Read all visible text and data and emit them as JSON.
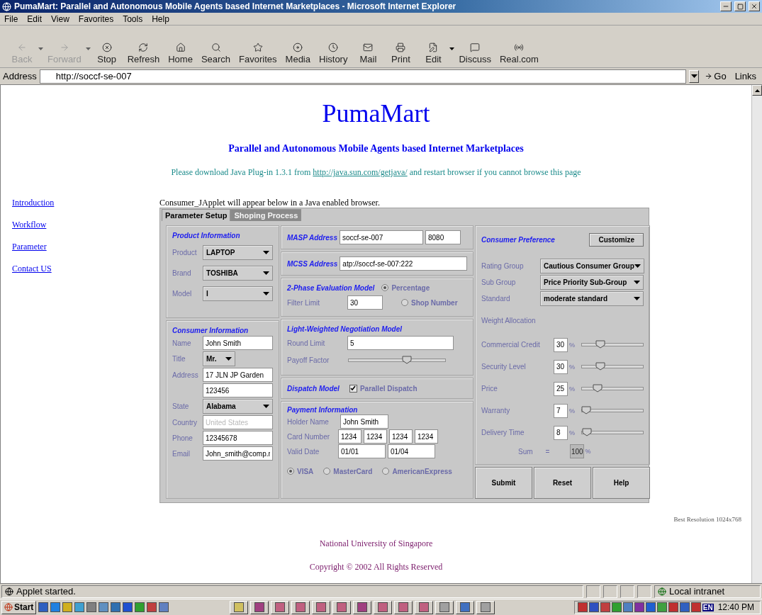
{
  "window": {
    "title": "PumaMart: Parallel and Autonomous Mobile Agents based Internet Marketplaces - Microsoft Internet Explorer"
  },
  "menu": [
    "File",
    "Edit",
    "View",
    "Favorites",
    "Tools",
    "Help"
  ],
  "toolbar": [
    {
      "label": "Back",
      "disabled": true,
      "dropdown": true
    },
    {
      "label": "Forward",
      "disabled": true,
      "dropdown": true
    },
    {
      "label": "Stop",
      "disabled": false,
      "dropdown": false
    },
    {
      "label": "Refresh",
      "disabled": false,
      "dropdown": false
    },
    {
      "label": "Home",
      "disabled": false,
      "dropdown": false
    },
    {
      "label": "Search",
      "disabled": false,
      "dropdown": false
    },
    {
      "label": "Favorites",
      "disabled": false,
      "dropdown": false
    },
    {
      "label": "Media",
      "disabled": false,
      "dropdown": false
    },
    {
      "label": "History",
      "disabled": false,
      "dropdown": false
    },
    {
      "label": "Mail",
      "disabled": false,
      "dropdown": false
    },
    {
      "label": "Print",
      "disabled": false,
      "dropdown": false
    },
    {
      "label": "Edit",
      "disabled": false,
      "dropdown": true
    },
    {
      "label": "Discuss",
      "disabled": false,
      "dropdown": false
    },
    {
      "label": "Real.com",
      "disabled": false,
      "dropdown": false
    }
  ],
  "address": {
    "label": "Address",
    "value": "http://soccf-se-007",
    "go": "Go",
    "links": "Links"
  },
  "page": {
    "title": "PumaMart",
    "subtitle": "Parallel and Autonomous Mobile Agents based Internet Marketplaces",
    "notice": {
      "before": "Please download Java Plug-in 1.3.1 from",
      "link": "http://java.sun.com/getjava/",
      "after": "and restart browser if you cannot browse this page"
    },
    "nav": [
      "Introduction",
      "Workflow",
      "Parameter",
      "Contact US"
    ],
    "applet_note": "Consumer_JApplet will appear below in a Java enabled browser.",
    "resolution": "Best Resolution 1024x768",
    "university": "National University of Singapore",
    "copyright": "Copyright © 2002 All Rights Reserved"
  },
  "applet": {
    "tabs": [
      {
        "label": "Parameter Setup",
        "selected": true
      },
      {
        "label": "Shoping Process",
        "selected": false
      }
    ],
    "product": {
      "heading": "Product Information",
      "fields": [
        {
          "label": "Product",
          "kind": "select",
          "value": "LAPTOP"
        },
        {
          "label": "Brand",
          "kind": "select",
          "value": "TOSHIBA"
        },
        {
          "label": "Model",
          "kind": "select",
          "value": "I"
        }
      ]
    },
    "consumer": {
      "heading": "Consumer Information",
      "fields": [
        {
          "label": "Name",
          "kind": "text",
          "value": "John Smith"
        },
        {
          "label": "Title",
          "kind": "small-select",
          "value": "Mr."
        },
        {
          "label": "Address",
          "kind": "text",
          "value": "17 JLN JP Garden"
        },
        {
          "kind": "text",
          "value": "123456"
        },
        {
          "label": "State",
          "kind": "select",
          "value": "Alabama"
        },
        {
          "label": "Country",
          "kind": "disabled",
          "value": "United States"
        },
        {
          "label": "Phone",
          "kind": "text",
          "value": "12345678"
        },
        {
          "label": "Email",
          "kind": "text",
          "value": "John_smith@comp.r"
        }
      ]
    },
    "masp": {
      "label": "MASP Address",
      "host": "soccf-se-007",
      "port": "8080"
    },
    "mcss": {
      "label": "MCSS Address",
      "value": "atp://soccf-se-007:222"
    },
    "evaluation": {
      "heading": "2-Phase Evaluation Model",
      "filter_label": "Filter Limit",
      "filter_value": "30",
      "options": [
        {
          "label": "Percentage",
          "selected": true
        },
        {
          "label": "Shop Number",
          "selected": false
        }
      ]
    },
    "negotiation": {
      "heading": "Light-Weighted Negotiation Model",
      "round_label": "Round Limit",
      "round_value": "5",
      "payoff_label": "Payoff Factor",
      "level": 0.6
    },
    "dispatch": {
      "heading": "Dispatch Model",
      "label": "Parallel Dispatch",
      "checked": true
    },
    "payment": {
      "heading": "Payment Information",
      "holder_label": "Holder Name",
      "holder": "John Smith",
      "card_label": "Card Number",
      "card": [
        "1234",
        "1234",
        "1234",
        "1234"
      ],
      "valid_label": "Valid Date",
      "valid": [
        "01/01",
        "01/04"
      ],
      "cards": [
        {
          "label": "VISA",
          "selected": true
        },
        {
          "label": "MasterCard",
          "selected": false
        },
        {
          "label": "AmericanExpress",
          "selected": false
        }
      ]
    },
    "preference": {
      "heading": "Consumer Preference",
      "customize": "Customize",
      "groups": [
        {
          "label": "Rating Group",
          "value": "Cautious Consumer Group"
        },
        {
          "label": "Sub Group",
          "value": "Price Priority Sub-Group"
        },
        {
          "label": "Standard",
          "value": "moderate standard"
        }
      ],
      "weight_heading": "Weight Allocation",
      "weights": [
        {
          "label": "Commercial Credit",
          "value": "30",
          "unit": "%",
          "level": 0.3
        },
        {
          "label": "Security Level",
          "value": "30",
          "unit": "%",
          "level": 0.3
        },
        {
          "label": "Price",
          "value": "25",
          "unit": "%",
          "level": 0.25
        },
        {
          "label": "Warranty",
          "value": "7",
          "unit": "%",
          "level": 0.07
        },
        {
          "label": "Delivery Time",
          "value": "8",
          "unit": "%",
          "level": 0.08
        }
      ],
      "sum": {
        "label": "Sum",
        "eq": "=",
        "value": "100",
        "unit": "%"
      }
    },
    "buttons": [
      "Submit",
      "Reset",
      "Help"
    ]
  },
  "status_bar": {
    "text": "Applet started.",
    "zone": "Local intranet"
  },
  "taskbar": {
    "start": "Start",
    "language": "EN",
    "clock": "12:40 PM"
  }
}
